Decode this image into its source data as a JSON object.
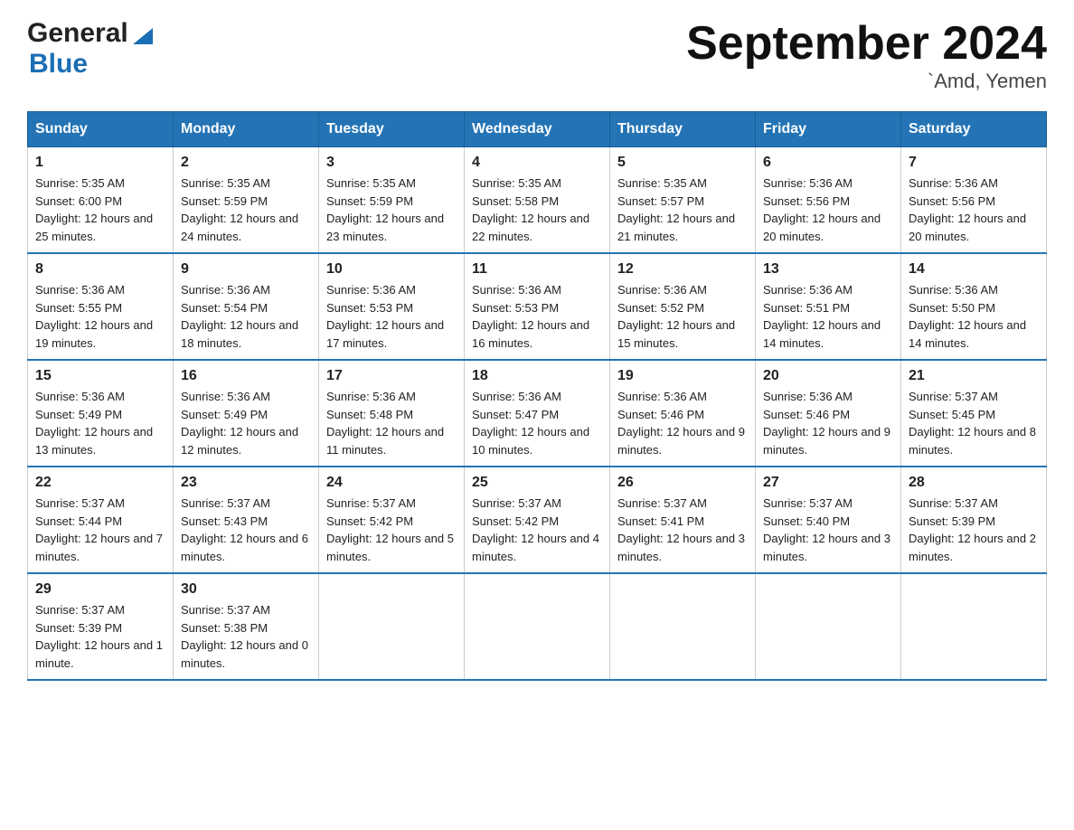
{
  "header": {
    "logo_general": "General",
    "logo_blue": "Blue",
    "title": "September 2024",
    "location": "`Amd, Yemen"
  },
  "weekdays": [
    "Sunday",
    "Monday",
    "Tuesday",
    "Wednesday",
    "Thursday",
    "Friday",
    "Saturday"
  ],
  "weeks": [
    [
      {
        "day": "1",
        "sunrise": "5:35 AM",
        "sunset": "6:00 PM",
        "daylight": "12 hours and 25 minutes."
      },
      {
        "day": "2",
        "sunrise": "5:35 AM",
        "sunset": "5:59 PM",
        "daylight": "12 hours and 24 minutes."
      },
      {
        "day": "3",
        "sunrise": "5:35 AM",
        "sunset": "5:59 PM",
        "daylight": "12 hours and 23 minutes."
      },
      {
        "day": "4",
        "sunrise": "5:35 AM",
        "sunset": "5:58 PM",
        "daylight": "12 hours and 22 minutes."
      },
      {
        "day": "5",
        "sunrise": "5:35 AM",
        "sunset": "5:57 PM",
        "daylight": "12 hours and 21 minutes."
      },
      {
        "day": "6",
        "sunrise": "5:36 AM",
        "sunset": "5:56 PM",
        "daylight": "12 hours and 20 minutes."
      },
      {
        "day": "7",
        "sunrise": "5:36 AM",
        "sunset": "5:56 PM",
        "daylight": "12 hours and 20 minutes."
      }
    ],
    [
      {
        "day": "8",
        "sunrise": "5:36 AM",
        "sunset": "5:55 PM",
        "daylight": "12 hours and 19 minutes."
      },
      {
        "day": "9",
        "sunrise": "5:36 AM",
        "sunset": "5:54 PM",
        "daylight": "12 hours and 18 minutes."
      },
      {
        "day": "10",
        "sunrise": "5:36 AM",
        "sunset": "5:53 PM",
        "daylight": "12 hours and 17 minutes."
      },
      {
        "day": "11",
        "sunrise": "5:36 AM",
        "sunset": "5:53 PM",
        "daylight": "12 hours and 16 minutes."
      },
      {
        "day": "12",
        "sunrise": "5:36 AM",
        "sunset": "5:52 PM",
        "daylight": "12 hours and 15 minutes."
      },
      {
        "day": "13",
        "sunrise": "5:36 AM",
        "sunset": "5:51 PM",
        "daylight": "12 hours and 14 minutes."
      },
      {
        "day": "14",
        "sunrise": "5:36 AM",
        "sunset": "5:50 PM",
        "daylight": "12 hours and 14 minutes."
      }
    ],
    [
      {
        "day": "15",
        "sunrise": "5:36 AM",
        "sunset": "5:49 PM",
        "daylight": "12 hours and 13 minutes."
      },
      {
        "day": "16",
        "sunrise": "5:36 AM",
        "sunset": "5:49 PM",
        "daylight": "12 hours and 12 minutes."
      },
      {
        "day": "17",
        "sunrise": "5:36 AM",
        "sunset": "5:48 PM",
        "daylight": "12 hours and 11 minutes."
      },
      {
        "day": "18",
        "sunrise": "5:36 AM",
        "sunset": "5:47 PM",
        "daylight": "12 hours and 10 minutes."
      },
      {
        "day": "19",
        "sunrise": "5:36 AM",
        "sunset": "5:46 PM",
        "daylight": "12 hours and 9 minutes."
      },
      {
        "day": "20",
        "sunrise": "5:36 AM",
        "sunset": "5:46 PM",
        "daylight": "12 hours and 9 minutes."
      },
      {
        "day": "21",
        "sunrise": "5:37 AM",
        "sunset": "5:45 PM",
        "daylight": "12 hours and 8 minutes."
      }
    ],
    [
      {
        "day": "22",
        "sunrise": "5:37 AM",
        "sunset": "5:44 PM",
        "daylight": "12 hours and 7 minutes."
      },
      {
        "day": "23",
        "sunrise": "5:37 AM",
        "sunset": "5:43 PM",
        "daylight": "12 hours and 6 minutes."
      },
      {
        "day": "24",
        "sunrise": "5:37 AM",
        "sunset": "5:42 PM",
        "daylight": "12 hours and 5 minutes."
      },
      {
        "day": "25",
        "sunrise": "5:37 AM",
        "sunset": "5:42 PM",
        "daylight": "12 hours and 4 minutes."
      },
      {
        "day": "26",
        "sunrise": "5:37 AM",
        "sunset": "5:41 PM",
        "daylight": "12 hours and 3 minutes."
      },
      {
        "day": "27",
        "sunrise": "5:37 AM",
        "sunset": "5:40 PM",
        "daylight": "12 hours and 3 minutes."
      },
      {
        "day": "28",
        "sunrise": "5:37 AM",
        "sunset": "5:39 PM",
        "daylight": "12 hours and 2 minutes."
      }
    ],
    [
      {
        "day": "29",
        "sunrise": "5:37 AM",
        "sunset": "5:39 PM",
        "daylight": "12 hours and 1 minute."
      },
      {
        "day": "30",
        "sunrise": "5:37 AM",
        "sunset": "5:38 PM",
        "daylight": "12 hours and 0 minutes."
      },
      null,
      null,
      null,
      null,
      null
    ]
  ],
  "labels": {
    "sunrise": "Sunrise:",
    "sunset": "Sunset:",
    "daylight": "Daylight:"
  }
}
